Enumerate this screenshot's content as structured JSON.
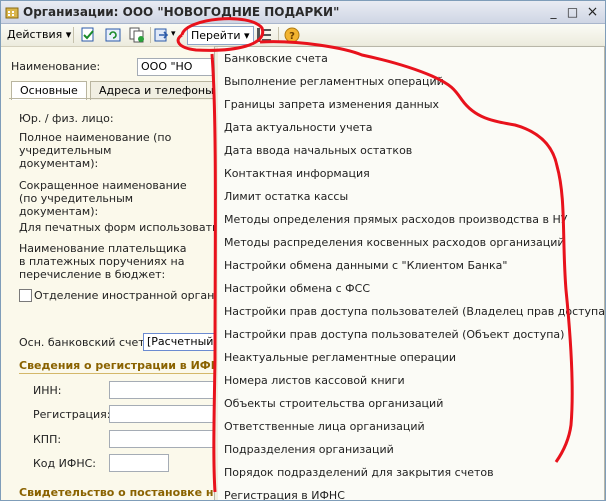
{
  "window": {
    "title": "Организации: ООО \"НОВОГОДНИЕ ПОДАРКИ\"",
    "minimize": "_",
    "maximize": "□",
    "close": "×"
  },
  "toolbar": {
    "actions_label": "Действия",
    "goto_label": "Перейти",
    "help_label": "?"
  },
  "form": {
    "name_label": "Наименование:",
    "name_value": "ООО \"НО",
    "tabs": [
      "Основные",
      "Адреса и телефоны"
    ],
    "legal_label": "Юр. / физ. лицо:",
    "full_name_label": "Полное наименование (по учредительным документам):",
    "short_name_label": "Сокращенное наименование (по учредительным документам):",
    "print_label": "Для печатных форм использовать",
    "payer_label": "Наименование плательщика в платежных поручениях на перечисление в бюджет:",
    "foreign_label": "Отделение иностранной организации",
    "bank_label": "Осн. банковский счет:",
    "bank_value": "[Расчетный",
    "reg_section": "Сведения о регистрации в ИФНС",
    "inn_label": "ИНН:",
    "reg_label": "Регистрация:",
    "kpp_label": "КПП:",
    "ifns_label": "Код ИФНС:",
    "cert_section": "Свидетельство о постановке на учет"
  },
  "menu": {
    "items": [
      "Банковские счета",
      "Выполнение регламентных операций",
      "Границы запрета изменения данных",
      "Дата актуальности учета",
      "Дата ввода начальных остатков",
      "Контактная информация",
      "Лимит остатка кассы",
      "Методы определения прямых расходов производства в НУ",
      "Методы распределения косвенных расходов организаций",
      "Настройки обмена данными с \"Клиентом Банка\"",
      "Настройки обмена с ФСС",
      "Настройки прав доступа пользователей (Владелец прав доступа)",
      "Настройки прав доступа пользователей (Объект доступа)",
      "Неактуальные регламентные операции",
      "Номера листов кассовой книги",
      "Объекты строительства организаций",
      "Ответственные лица организаций",
      "Подразделения организаций",
      "Порядок подразделений для закрытия счетов",
      "Регистрация в ИФНС"
    ]
  },
  "colors": {
    "annotation": "#e8121c",
    "section_text": "#8a6200",
    "window_border": "#7f9db9"
  },
  "icons": [
    "org-icon",
    "post-icon",
    "refresh-icon",
    "copy-icon",
    "goto-arrow-icon",
    "structure-icon",
    "help-icon"
  ]
}
